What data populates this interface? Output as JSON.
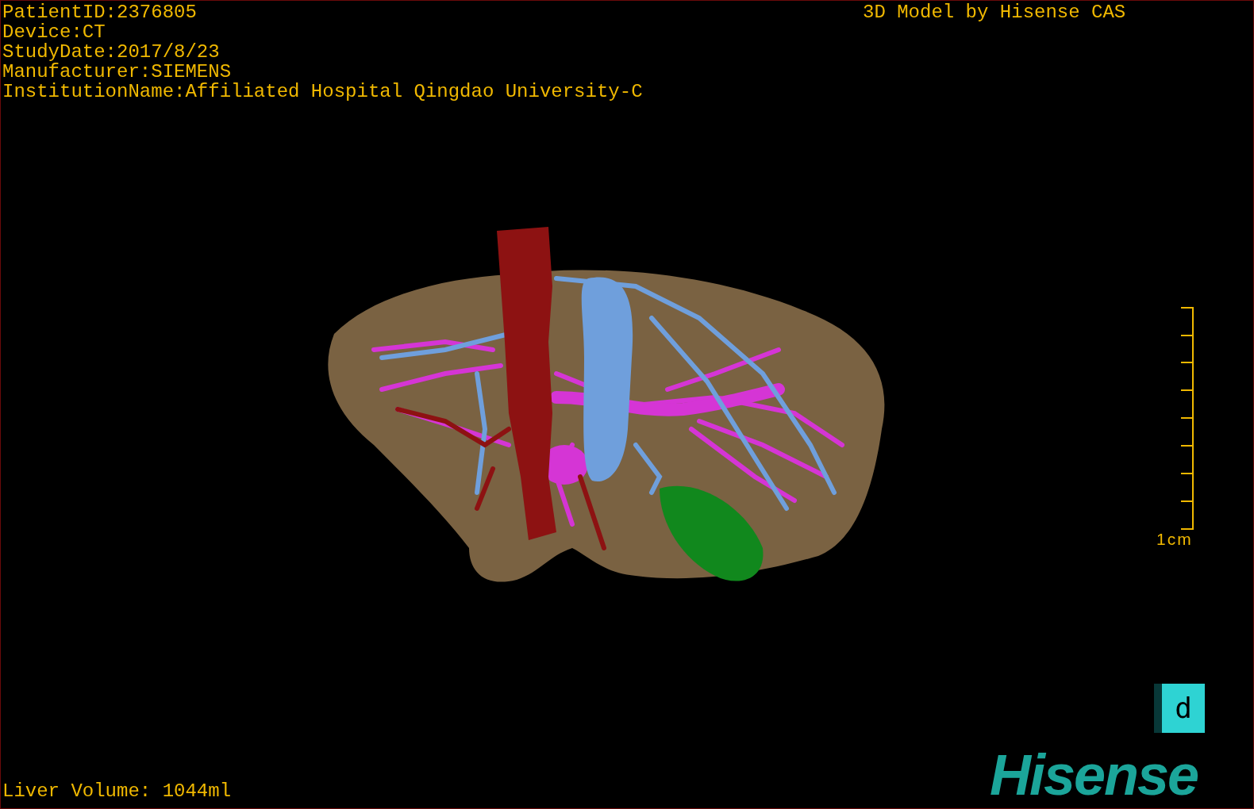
{
  "patient_info": [
    "PatientID:2376805",
    "Device:CT",
    "StudyDate:2017/8/23",
    "Manufacturer:SIEMENS",
    "InstitutionName:Affiliated Hospital Qingdao University-C"
  ],
  "model_title": "3D Model by Hisense CAS",
  "scale_bar": {
    "label": "1cm"
  },
  "view_button": {
    "label": "d"
  },
  "logo": "Hisense",
  "liver_volume": "Liver Volume: 1044ml"
}
